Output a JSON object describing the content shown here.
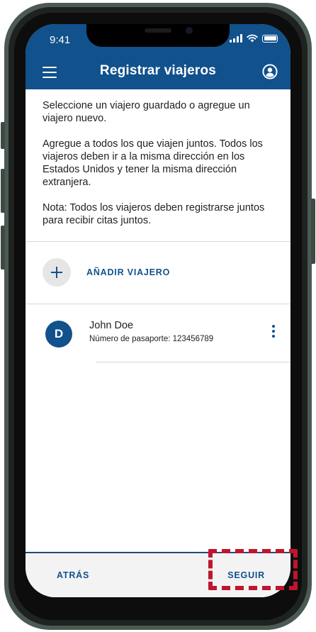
{
  "status_bar": {
    "time": "9:41"
  },
  "header": {
    "title": "Registrar viajeros"
  },
  "intro": {
    "p1": "Seleccione un viajero guardado o agregue un viajero nuevo.",
    "p2": "Agregue a todos los que viajen juntos.  Todos los viajeros deben ir a la misma dirección en los Estados Unidos y tener la misma dirección extranjera.",
    "p3": "Nota: Todos los viajeros deben registrarse juntos para recibir citas juntos."
  },
  "add_traveler": {
    "label": "AÑADIR VIAJERO"
  },
  "travelers": [
    {
      "initial": "D",
      "name": "John Doe",
      "passport": "Número de pasaporte: 123456789"
    }
  ],
  "footer": {
    "back_label": "ATRÁS",
    "next_label": "SEGUIR"
  },
  "colors": {
    "brand": "#11518c",
    "highlight": "#c0152f",
    "footer_bg": "#f3f3f3"
  },
  "icons": [
    "menu-icon",
    "account-icon",
    "plus-icon",
    "more-vertical-icon",
    "signal-icon",
    "wifi-icon",
    "battery-icon"
  ]
}
